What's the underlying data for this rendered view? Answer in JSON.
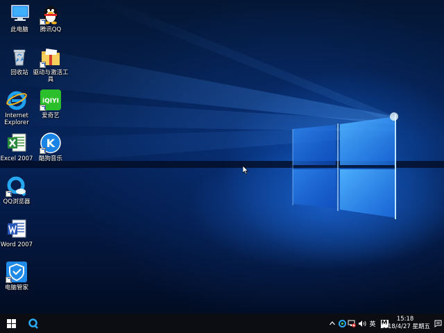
{
  "desktop": {
    "icons": [
      {
        "label": "此电脑",
        "icon": "computer-icon"
      },
      {
        "label": "腾讯QQ",
        "icon": "qq-penguin-icon"
      },
      {
        "label": "回收站",
        "icon": "recycle-bin-icon"
      },
      {
        "label": "驱动与激活工\n具",
        "icon": "tools-folder-icon"
      },
      {
        "label": "Internet\nExplorer",
        "icon": "internet-explorer-icon"
      },
      {
        "label": "爱奇艺",
        "icon": "iqiyi-icon"
      },
      {
        "label": "Excel 2007",
        "icon": "excel-icon"
      },
      {
        "label": "酷狗音乐",
        "icon": "kugou-icon"
      },
      {
        "label": "QQ浏览器",
        "icon": "qq-browser-icon"
      },
      {
        "label": "Word 2007",
        "icon": "word-icon"
      },
      {
        "label": "电脑管家",
        "icon": "pc-manager-icon"
      }
    ],
    "iqiyi_logo_text": "iQIYI",
    "kugou_logo_text": "K",
    "colors": {
      "wallpaper_glow": "#2f8cff",
      "taskbar": "#0b0d12"
    }
  },
  "taskbar": {
    "start_icon": "windows-start-icon",
    "search_icon": "qq-browser-taskbar-icon",
    "tray": {
      "ime_label": "英",
      "ime_mode_label": "M",
      "time": "15:18",
      "date": "2018/4/27 星期五"
    }
  }
}
